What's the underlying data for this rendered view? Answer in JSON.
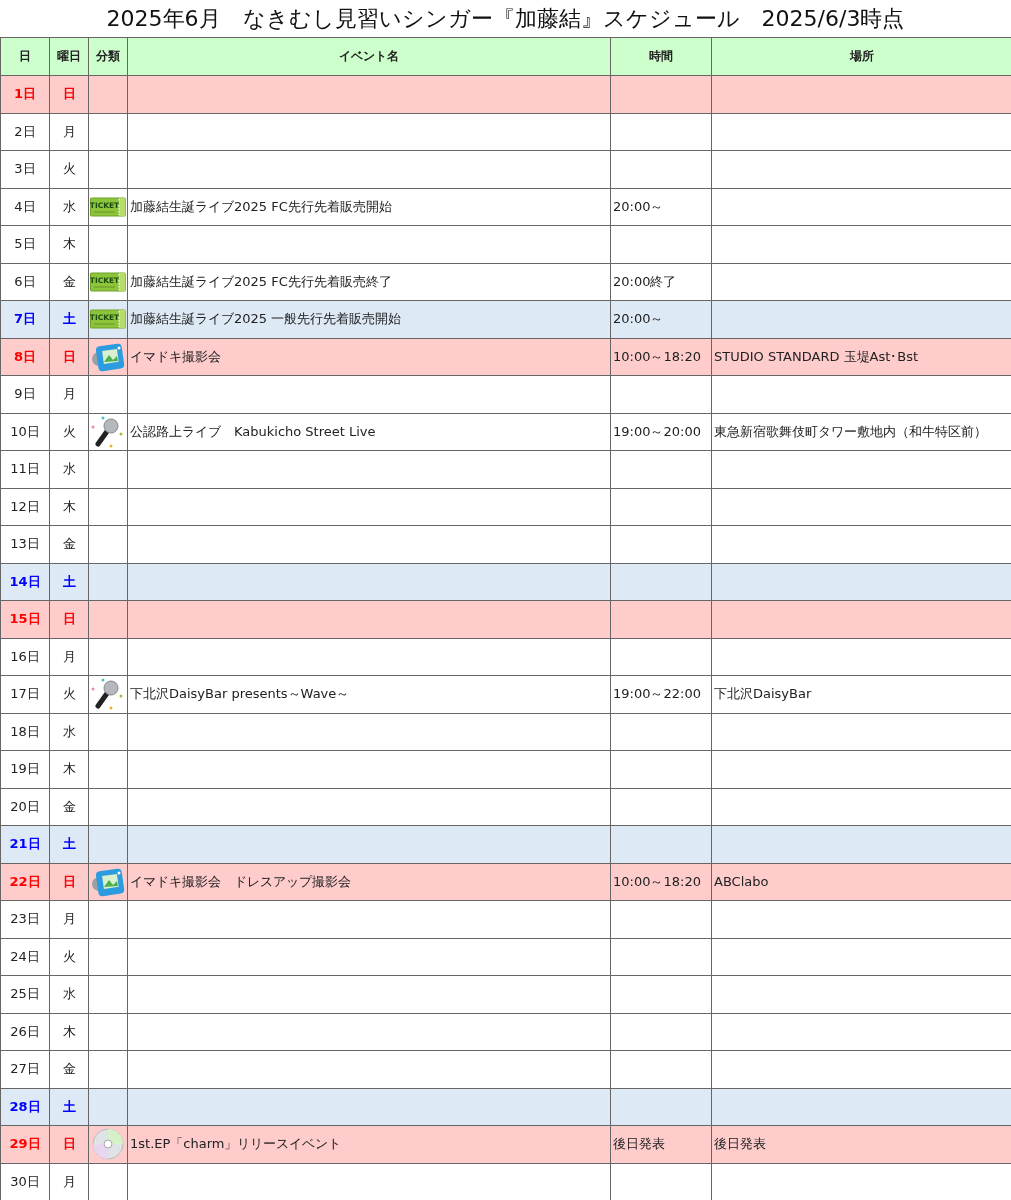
{
  "title": "2025年6月　なきむし見習いシンガー『加藤結』スケジュール　2025/6/3時点",
  "columns": [
    "日",
    "曜日",
    "分類",
    "イベント名",
    "時間",
    "場所"
  ],
  "rows": [
    {
      "day": "1日",
      "weekday": "日",
      "kind": "sunday"
    },
    {
      "day": "2日",
      "weekday": "月",
      "kind": "weekday"
    },
    {
      "day": "3日",
      "weekday": "火",
      "kind": "weekday"
    },
    {
      "day": "4日",
      "weekday": "水",
      "kind": "weekday",
      "category": {
        "kind": "ticket",
        "label": "TICKET"
      },
      "event": "加藤結生誕ライブ2025 FC先行先着販売開始",
      "time": "20:00～"
    },
    {
      "day": "5日",
      "weekday": "木",
      "kind": "weekday"
    },
    {
      "day": "6日",
      "weekday": "金",
      "kind": "weekday",
      "category": {
        "kind": "ticket",
        "label": "TICKET"
      },
      "event": "加藤結生誕ライブ2025 FC先行先着販売終了",
      "time": "20:00終了"
    },
    {
      "day": "7日",
      "weekday": "土",
      "kind": "saturday",
      "category": {
        "kind": "ticket",
        "label": "TICKET"
      },
      "event": "加藤結生誕ライブ2025 一般先行先着販売開始",
      "time": "20:00～"
    },
    {
      "day": "8日",
      "weekday": "日",
      "kind": "sunday",
      "category": {
        "kind": "camera"
      },
      "event": "イマドキ撮影会",
      "time": "10:00～18:20",
      "place": "STUDIO STANDARD 玉堤Ast･Bst"
    },
    {
      "day": "9日",
      "weekday": "月",
      "kind": "weekday"
    },
    {
      "day": "10日",
      "weekday": "火",
      "kind": "weekday",
      "category": {
        "kind": "microphone"
      },
      "event": "公認路上ライブ　Kabukicho Street Live",
      "time": "19:00～20:00",
      "place": "東急新宿歌舞伎町タワー敷地内（和牛特区前）"
    },
    {
      "day": "11日",
      "weekday": "水",
      "kind": "weekday"
    },
    {
      "day": "12日",
      "weekday": "木",
      "kind": "weekday"
    },
    {
      "day": "13日",
      "weekday": "金",
      "kind": "weekday"
    },
    {
      "day": "14日",
      "weekday": "土",
      "kind": "saturday"
    },
    {
      "day": "15日",
      "weekday": "日",
      "kind": "sunday"
    },
    {
      "day": "16日",
      "weekday": "月",
      "kind": "weekday"
    },
    {
      "day": "17日",
      "weekday": "火",
      "kind": "weekday",
      "category": {
        "kind": "microphone"
      },
      "event": "下北沢DaisyBar presents～Wave～",
      "time": "19:00～22:00",
      "place": "下北沢DaisyBar"
    },
    {
      "day": "18日",
      "weekday": "水",
      "kind": "weekday"
    },
    {
      "day": "19日",
      "weekday": "木",
      "kind": "weekday"
    },
    {
      "day": "20日",
      "weekday": "金",
      "kind": "weekday"
    },
    {
      "day": "21日",
      "weekday": "土",
      "kind": "saturday"
    },
    {
      "day": "22日",
      "weekday": "日",
      "kind": "sunday",
      "category": {
        "kind": "camera"
      },
      "event": "イマドキ撮影会　ドレスアップ撮影会",
      "time": "10:00～18:20",
      "place": "ABClabo"
    },
    {
      "day": "23日",
      "weekday": "月",
      "kind": "weekday"
    },
    {
      "day": "24日",
      "weekday": "火",
      "kind": "weekday"
    },
    {
      "day": "25日",
      "weekday": "水",
      "kind": "weekday"
    },
    {
      "day": "26日",
      "weekday": "木",
      "kind": "weekday"
    },
    {
      "day": "27日",
      "weekday": "金",
      "kind": "weekday"
    },
    {
      "day": "28日",
      "weekday": "土",
      "kind": "saturday"
    },
    {
      "day": "29日",
      "weekday": "日",
      "kind": "sunday",
      "category": {
        "kind": "cd"
      },
      "event": "1st.EP「charm」リリースイベント",
      "time": "後日発表",
      "place": "後日発表"
    },
    {
      "day": "30日",
      "weekday": "月",
      "kind": "weekday"
    }
  ]
}
